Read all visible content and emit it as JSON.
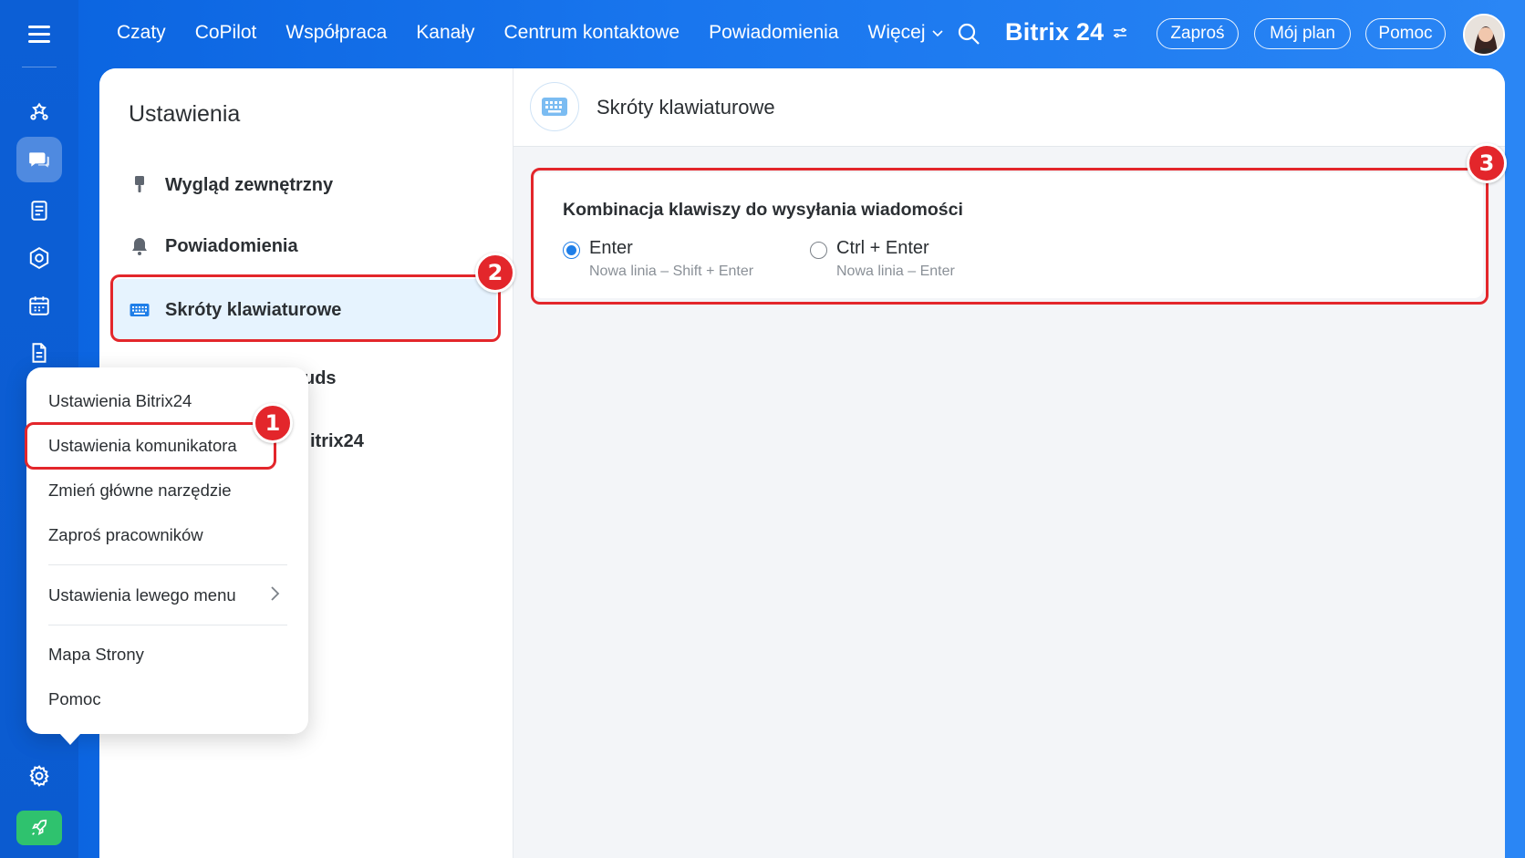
{
  "topbar": {
    "nav": [
      "Czaty",
      "CoPilot",
      "Współpraca",
      "Kanały",
      "Centrum kontaktowe",
      "Powiadomienia",
      "Więcej"
    ],
    "brand": "Bitrix 24",
    "invite": "Zaproś",
    "plan": "Mój plan",
    "help": "Pomoc"
  },
  "settings": {
    "title": "Ustawienia",
    "items": [
      {
        "label": "Wygląd zewnętrzny",
        "icon": "brush-icon"
      },
      {
        "label": "Powiadomienia",
        "icon": "bell-icon"
      },
      {
        "label": "Skróty klawiaturowe",
        "icon": "keyboard-icon",
        "active": true
      }
    ],
    "peek_items": [
      "uds",
      "itrix24"
    ]
  },
  "content": {
    "title": "Skróty klawiaturowe",
    "box_title": "Kombinacja klawiszy do wysyłania wiadomości",
    "options": [
      {
        "label": "Enter",
        "hint": "Nowa linia – Shift + Enter",
        "checked": true
      },
      {
        "label": "Ctrl + Enter",
        "hint": "Nowa linia – Enter",
        "checked": false
      }
    ]
  },
  "popup": {
    "items": [
      "Ustawienia Bitrix24",
      "Ustawienia komunikatora",
      "Zmień główne narzędzie",
      "Zaproś pracowników",
      "Ustawienia lewego menu",
      "Mapa Strony",
      "Pomoc"
    ]
  },
  "annotations": {
    "steps": [
      "1",
      "2",
      "3"
    ],
    "color": "#e3262b"
  },
  "colors": {
    "brand_blue": "#1976ee",
    "active_item_bg": "#e6f3fe",
    "radio_checked": "#1e7ee8",
    "rocket_green": "#2fc26e"
  }
}
